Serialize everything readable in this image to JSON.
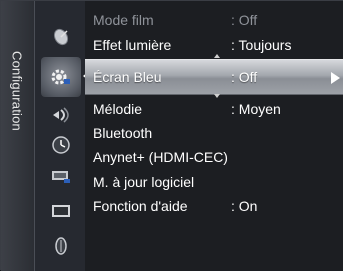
{
  "menu": {
    "category": "Configuration",
    "items": [
      {
        "label": "Mode film",
        "value": ": Off"
      },
      {
        "label": "Effet lumière",
        "value": ": Toujours"
      },
      {
        "label": "Écran Bleu",
        "value": ": Off"
      },
      {
        "label": "Mélodie",
        "value": ": Moyen"
      },
      {
        "label": "Bluetooth",
        "value": ""
      },
      {
        "label": "Anynet+ (HDMI-CEC)",
        "value": ""
      },
      {
        "label": "M. à jour logiciel",
        "value": ""
      },
      {
        "label": "Fonction d'aide",
        "value": ": On"
      }
    ],
    "selected_index": 2
  },
  "icons": [
    "satellite-dish-icon",
    "gear-setup-icon",
    "sound-wave-icon",
    "clock-icon",
    "input-icon",
    "screen-icon",
    "support-icon"
  ],
  "colors": {
    "background": "#1c1e22",
    "highlight": "#a3a7ad",
    "text": "#ffffff",
    "dim_text": "#8f939a"
  }
}
